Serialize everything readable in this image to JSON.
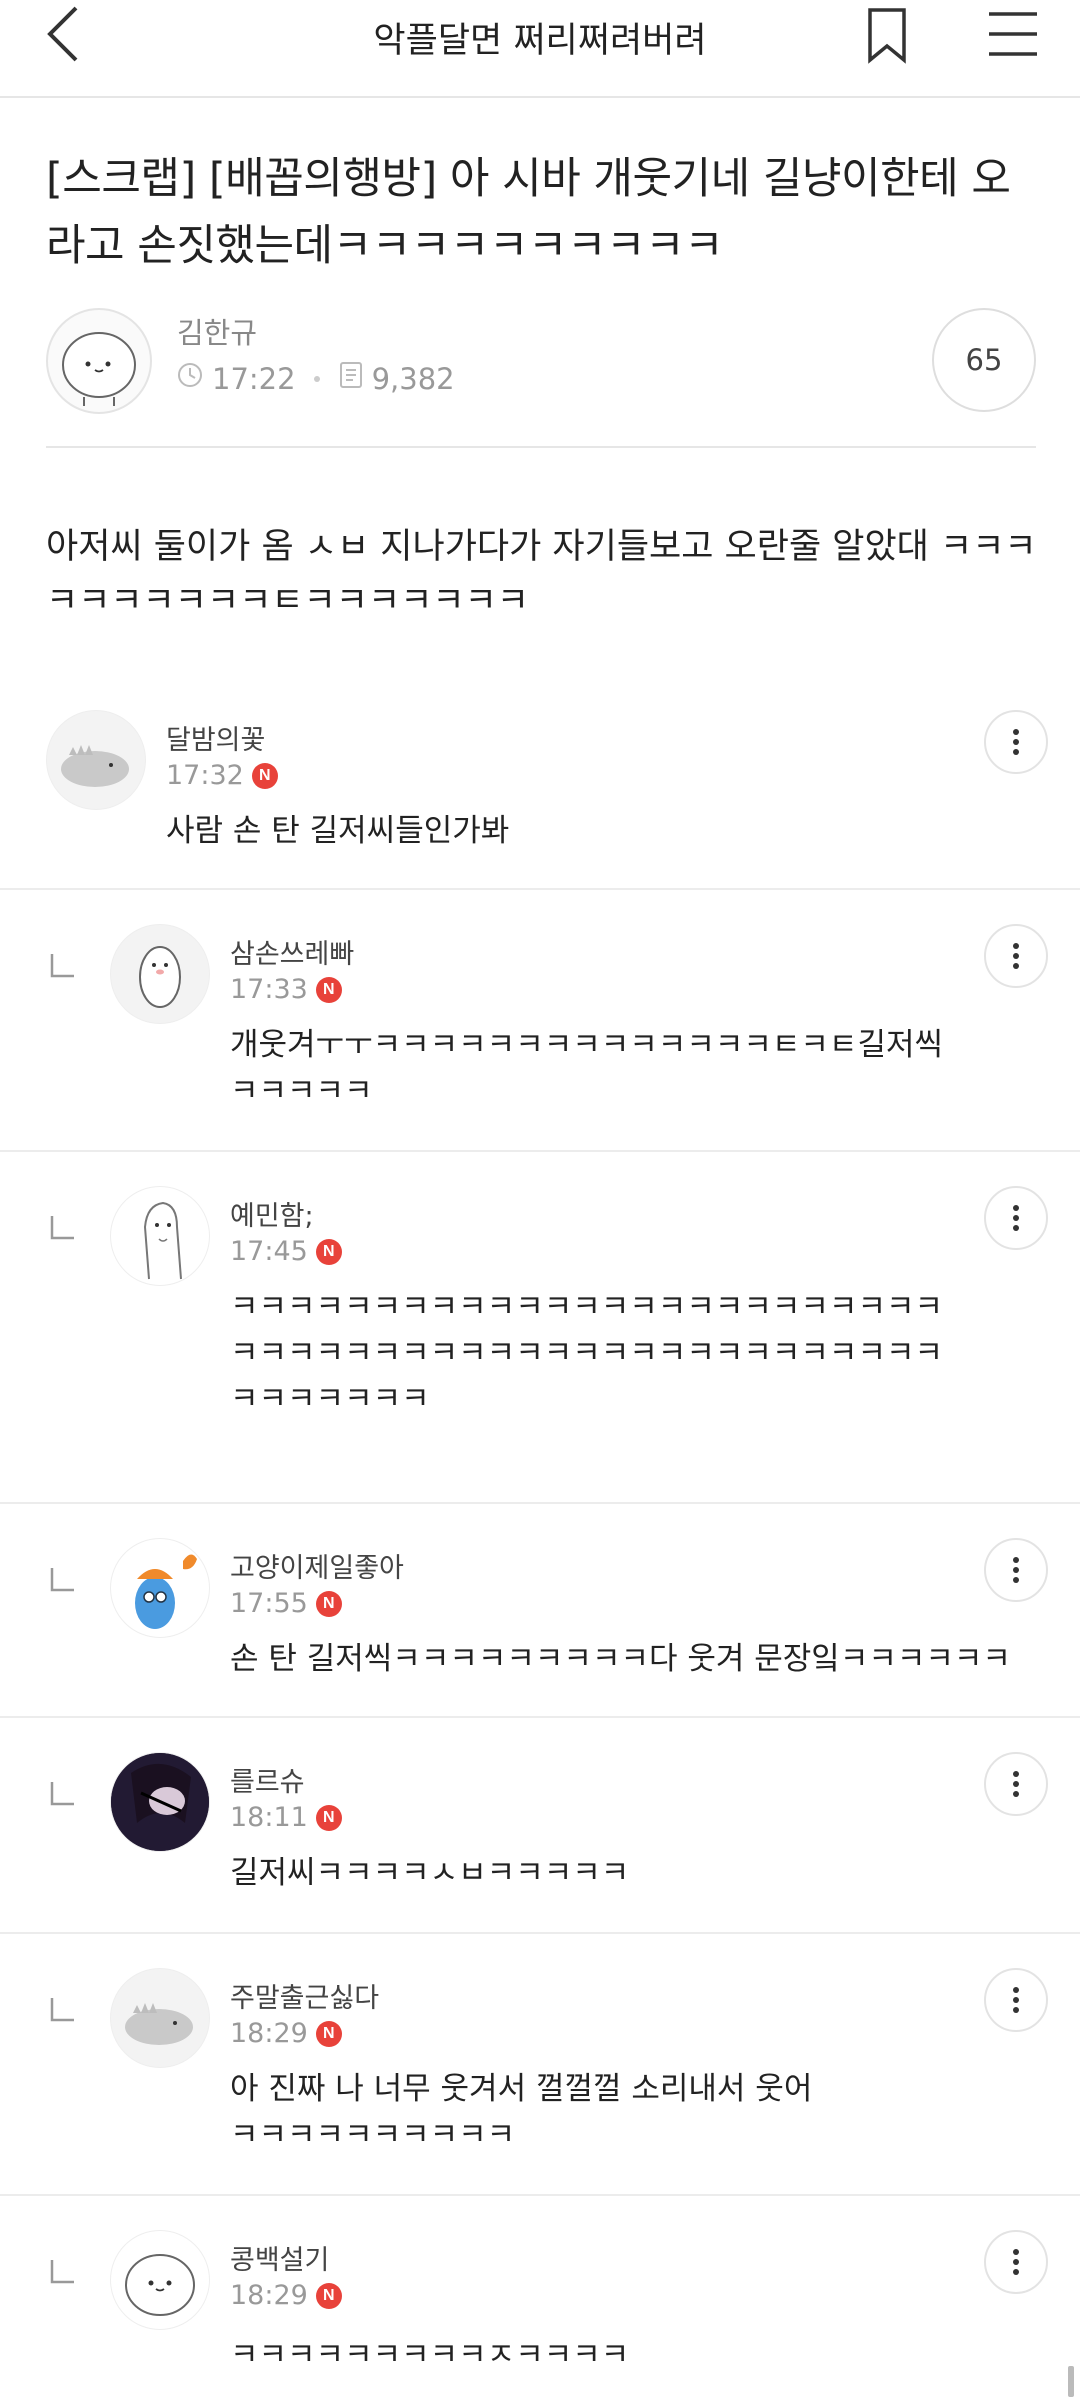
{
  "header": {
    "title": "악플달면 쩌리쩌려버려",
    "back_icon": "back-arrow-icon",
    "bookmark_icon": "bookmark-icon",
    "menu_icon": "hamburger-menu-icon"
  },
  "post": {
    "title": "[스크랩] [배꼽의행방] 아 시바 개웃기네 길냥이한테 오라고 손짓했는데ㅋㅋㅋㅋㅋㅋㅋㅋㅋㅋ",
    "author": "김한규",
    "time": "17:22",
    "views": "9,382",
    "comment_count": "65",
    "body": "아저씨 둘이가 옴 ㅅㅂ 지나가다가 자기들보고 오란줄 알았대 ㅋㅋㅋㅋㅋㅋㅋㅋㅋㅋㅌㅋㅋㅋㅋㅋㅋㅋ"
  },
  "comments": [
    {
      "name": "달밤의꽃",
      "time": "17:32",
      "badge": "N",
      "text": "사람 손 탄 길저씨들인가봐",
      "reply": false,
      "avatar": "dino-avatar"
    },
    {
      "name": "삼손쓰레빠",
      "time": "17:33",
      "badge": "N",
      "text": "개웃겨ㅜㅜㅋㅋㅋㅋㅋㅋㅋㅋㅋㅋㅋㅋㅋㅋㅌㅋㅌ길저씩ㅋㅋㅋㅋㅋ",
      "reply": true,
      "avatar": "penguin-avatar"
    },
    {
      "name": "예민함;",
      "time": "17:45",
      "badge": "N",
      "text": "ㅋㅋㅋㅋㅋㅋㅋㅋㅋㅋㅋㅋㅋㅋㅋㅋㅋㅋㅋㅋㅋㅋㅋㅋㅋㅋㅋㅋㅋㅋㅋㅋㅋㅋㅋㅋㅋㅋㅋㅋㅋㅋㅋㅋㅋㅋㅋㅋㅋㅋㅋㅋㅋㅋㅋㅋㅋ",
      "reply": true,
      "avatar": "sketch-avatar"
    },
    {
      "name": "고양이제일좋아",
      "time": "17:55",
      "badge": "N",
      "text": "손 탄 길저씩ㅋㅋㅋㅋㅋㅋㅋㅋㅋ다 웃겨 문장잌ㅋㅋㅋㅋㅋㅋ",
      "reply": true,
      "avatar": "blue-character-avatar"
    },
    {
      "name": "를르슈",
      "time": "18:11",
      "badge": "N",
      "text": "길저씨ㅋㅋㅋㅋㅅㅂㅋㅋㅋㅋㅋ",
      "reply": true,
      "avatar": "anime-avatar"
    },
    {
      "name": "주말출근싫다",
      "time": "18:29",
      "badge": "N",
      "text": "아 진짜 나 너무 웃겨서 껄껄껄 소리내서 웃어 ㅋㅋㅋㅋㅋㅋㅋㅋㅋㅋ",
      "reply": true,
      "avatar": "dino-avatar"
    },
    {
      "name": "콩백설기",
      "time": "18:29",
      "badge": "N",
      "text": "ㅋㅋㅋㅋㅋㅋㅋㅋㅋㅈㅋㅋㅋㅋ",
      "reply": true,
      "avatar": "blob-avatar"
    }
  ],
  "colors": {
    "badge": "#e8423a",
    "divider": "#ececec",
    "meta_text": "#999999"
  }
}
